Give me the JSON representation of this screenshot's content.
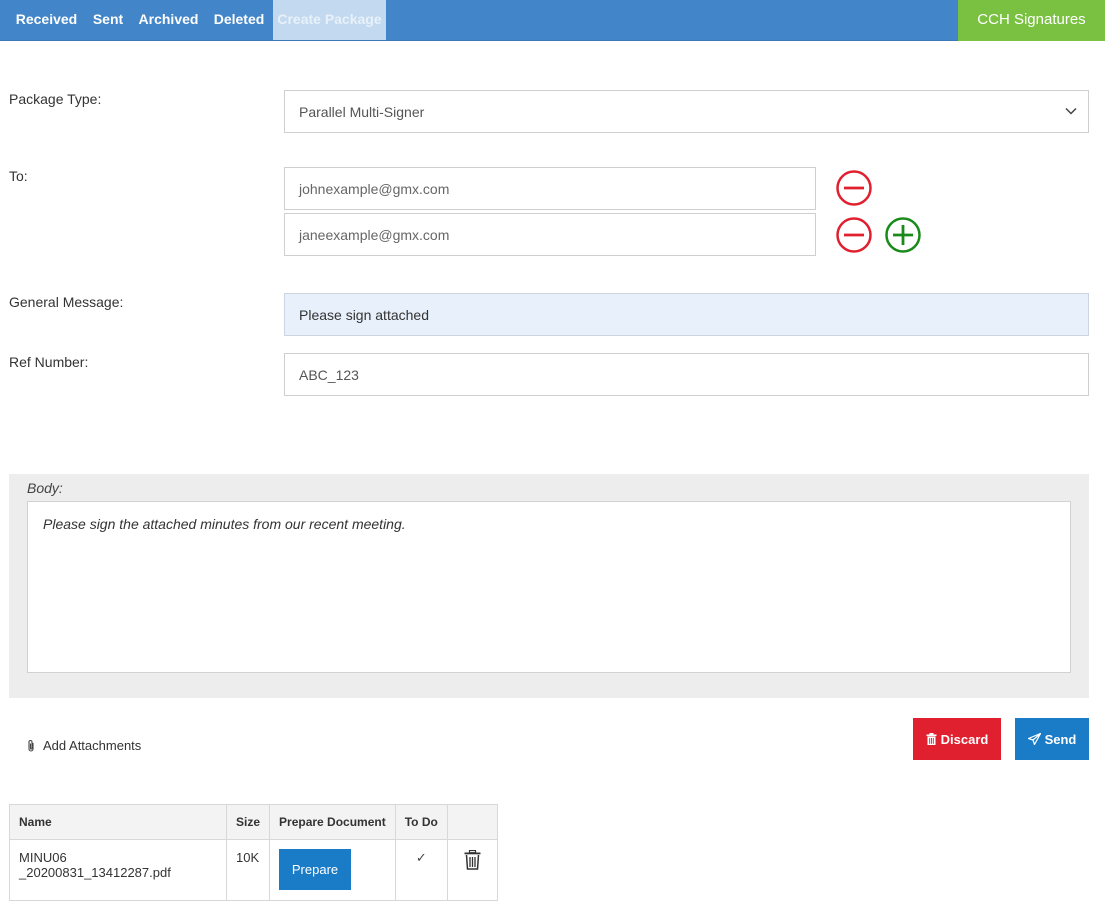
{
  "nav": {
    "tabs": [
      {
        "label": "Received"
      },
      {
        "label": "Sent"
      },
      {
        "label": "Archived"
      },
      {
        "label": "Deleted"
      },
      {
        "label": "Create Package",
        "active": true
      }
    ],
    "brand": "CCH Signatures"
  },
  "form": {
    "package_type_label": "Package Type:",
    "package_type_value": "Parallel Multi-Signer",
    "to_label": "To:",
    "recipients": [
      "johnexample@gmx.com",
      "janeexample@gmx.com"
    ],
    "general_message_label": "General Message:",
    "general_message_value": "Please sign attached",
    "ref_number_label": "Ref Number:",
    "ref_number_value": "ABC_123"
  },
  "body": {
    "label": "Body:",
    "text": "Please sign the attached minutes from our recent meeting."
  },
  "actions": {
    "add_attachments": "Add Attachments",
    "discard": "Discard",
    "send": "Send"
  },
  "attachments": {
    "headers": [
      "Name",
      "Size",
      "Prepare Document",
      "To Do",
      ""
    ],
    "rows": [
      {
        "name": "MINU06 _20200831_13412287.pdf",
        "size": "10K",
        "prepare": "Prepare",
        "todo": "✓"
      }
    ]
  },
  "colors": {
    "nav_bg": "#4285c8",
    "brand_bg": "#7ac142",
    "remove": "#e0202f",
    "add": "#1a8a1a",
    "primary": "#1a7cc7"
  }
}
